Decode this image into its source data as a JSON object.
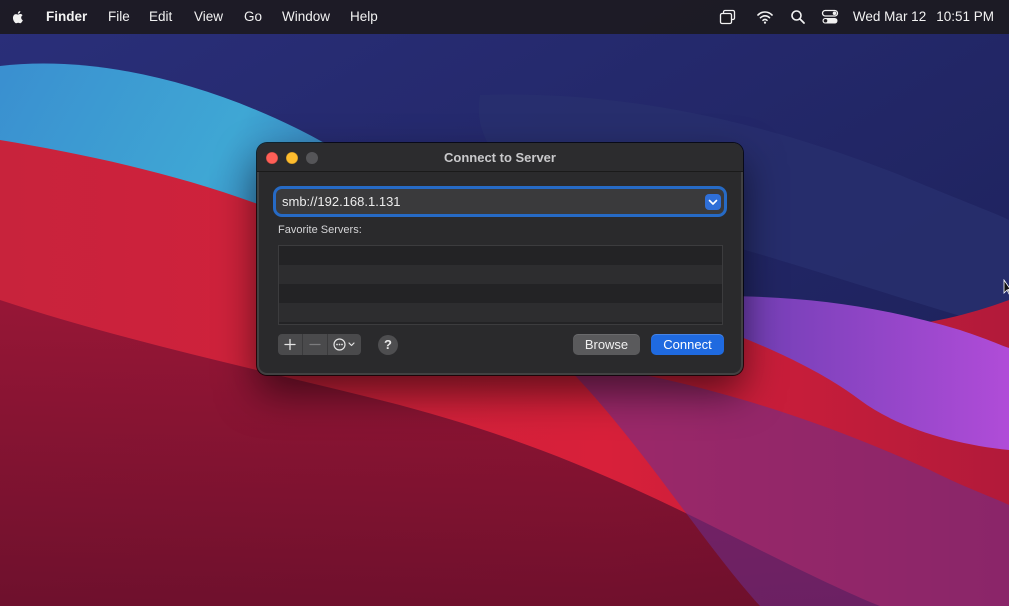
{
  "menubar": {
    "app_name": "Finder",
    "menus": [
      "File",
      "Edit",
      "View",
      "Go",
      "Window",
      "Help"
    ],
    "status_icons": [
      "screen-mirroring-icon",
      "wifi-icon",
      "spotlight-search-icon",
      "control-center-icon"
    ],
    "date": "Wed Mar 12",
    "time": "10:51 PM"
  },
  "dialog": {
    "title": "Connect to Server",
    "server_address": "smb://192.168.1.131",
    "favorites_label": "Favorite Servers:",
    "favorites": [],
    "browse_label": "Browse",
    "connect_label": "Connect",
    "help_label": "?"
  },
  "colors": {
    "accent": "#1f6ae0",
    "close": "#ff5f57",
    "minimize": "#febc2e"
  }
}
